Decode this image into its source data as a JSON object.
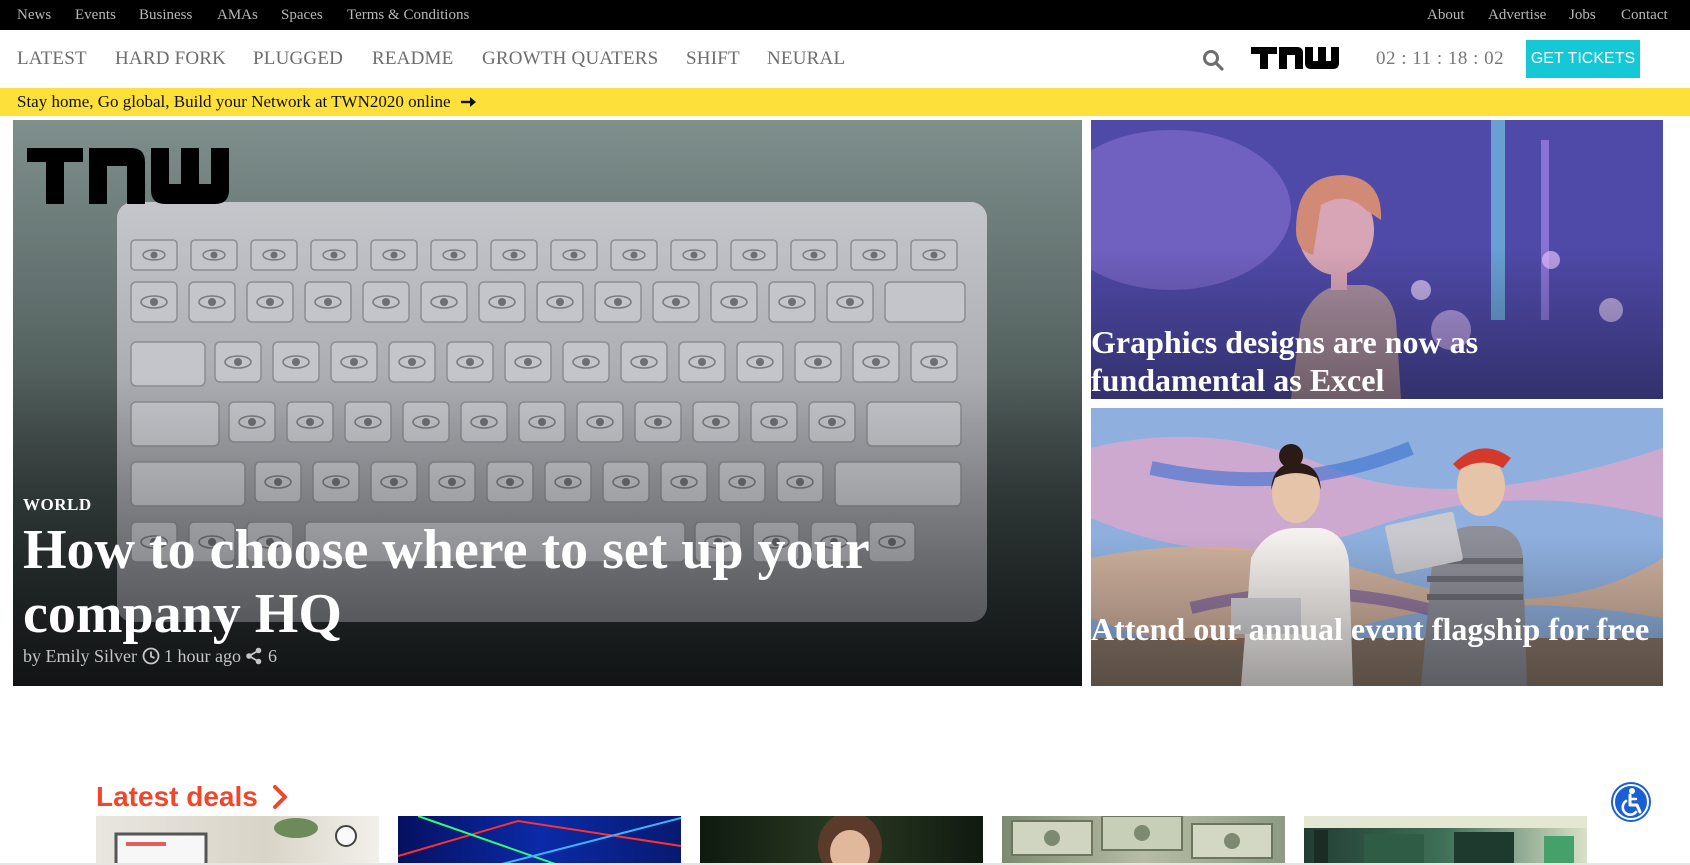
{
  "topbar": {
    "left_links": [
      "News",
      "Events",
      "Business",
      "AMAs",
      "Spaces",
      "Terms & Conditions"
    ],
    "right_links": [
      "About",
      "Advertise",
      "Jobs",
      "Contact"
    ]
  },
  "nav": {
    "items": [
      "LATEST",
      "HARD FORK",
      "PLUGGED",
      "README",
      "GROWTH QUATERS",
      "SHIFT",
      "NEURAL"
    ],
    "logo_text": "TNW",
    "countdown": "02 : 11 : 18 : 02",
    "tickets_label": "GET TICKETS"
  },
  "banner": {
    "text": "Stay home, Go global, Build your Network at TWN2020 online"
  },
  "hero": {
    "category": "WORLD",
    "title": "How to choose where to set up your company HQ",
    "author": "by Emily Silver",
    "time": "1 hour ago",
    "shares": "6"
  },
  "side_stories": [
    {
      "title": "Graphics designs are now as fundamental as Excel"
    },
    {
      "title": "Attend our annual event flagship for free"
    }
  ],
  "deals": {
    "heading": "Latest deals"
  },
  "colors": {
    "topbar_bg": "#000000",
    "banner_bg": "#fde03a",
    "tickets_bg": "#15c8d5",
    "deals_accent": "#f0472a",
    "a11y_blue": "#1a5fd6"
  }
}
